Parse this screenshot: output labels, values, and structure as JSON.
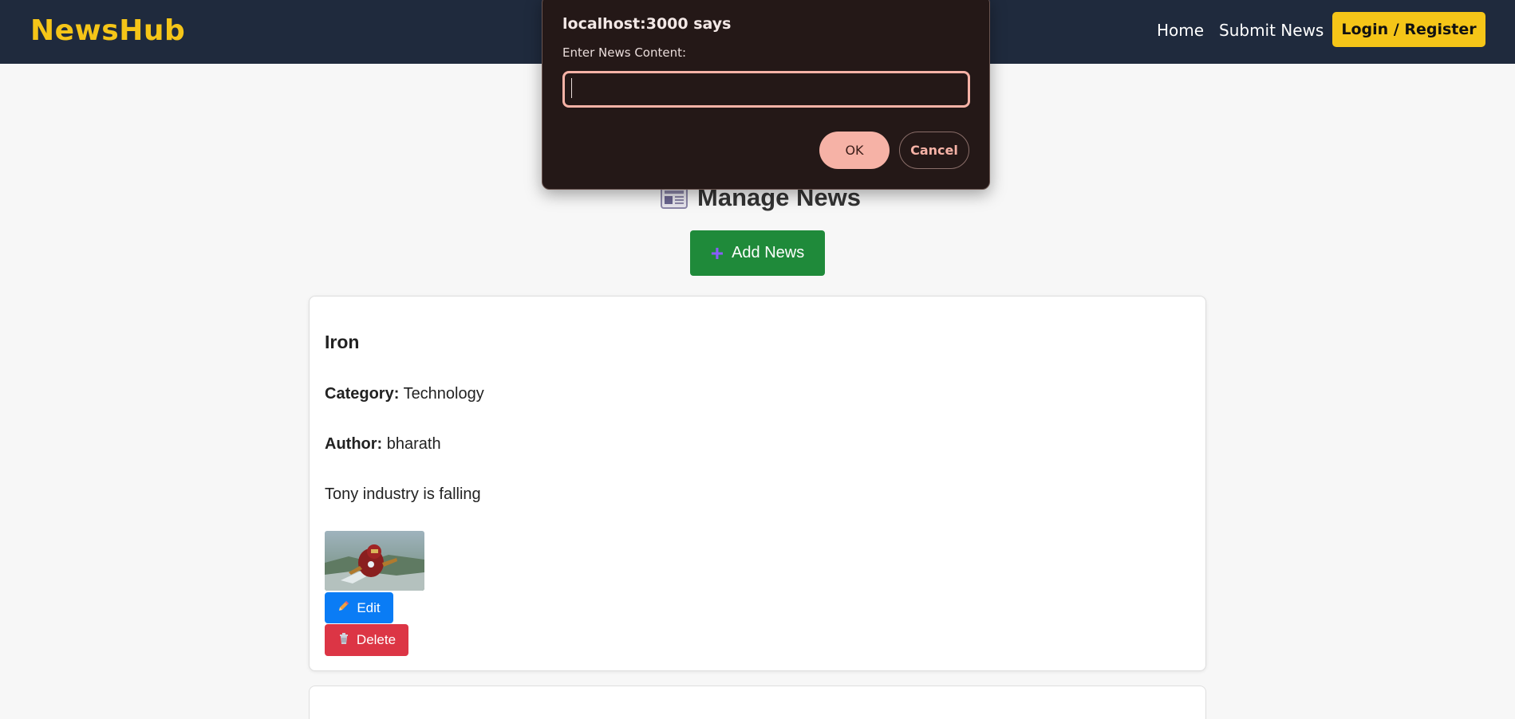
{
  "navbar": {
    "brand": "NewsHub",
    "links": [
      "Home",
      "Submit News"
    ],
    "login_label": "Login / Register"
  },
  "main": {
    "heading": "Manage News",
    "heading_icon": "newspaper-icon",
    "add_label": "Add News",
    "add_icon": "plus-icon"
  },
  "news": [
    {
      "title": "Iron",
      "category_label": "Category:",
      "category": "Technology",
      "author_label": "Author:",
      "author": "bharath",
      "content": "Tony industry is falling",
      "image": "iron-man-thumbnail",
      "edit_label": "Edit",
      "edit_icon": "pencil-icon",
      "delete_label": "Delete",
      "delete_icon": "trash-icon"
    }
  ],
  "dialog": {
    "title": "localhost:3000 says",
    "message": "Enter News Content:",
    "input_value": "",
    "ok_label": "OK",
    "cancel_label": "Cancel"
  },
  "colors": {
    "navbar_bg": "#1f2a3d",
    "brand": "#f5c518",
    "add_button": "#1f8a3a",
    "edit_button": "#0a7cf5",
    "delete_button": "#dc3545",
    "dialog_bg": "#241817",
    "dialog_accent": "#f6b2a6"
  }
}
